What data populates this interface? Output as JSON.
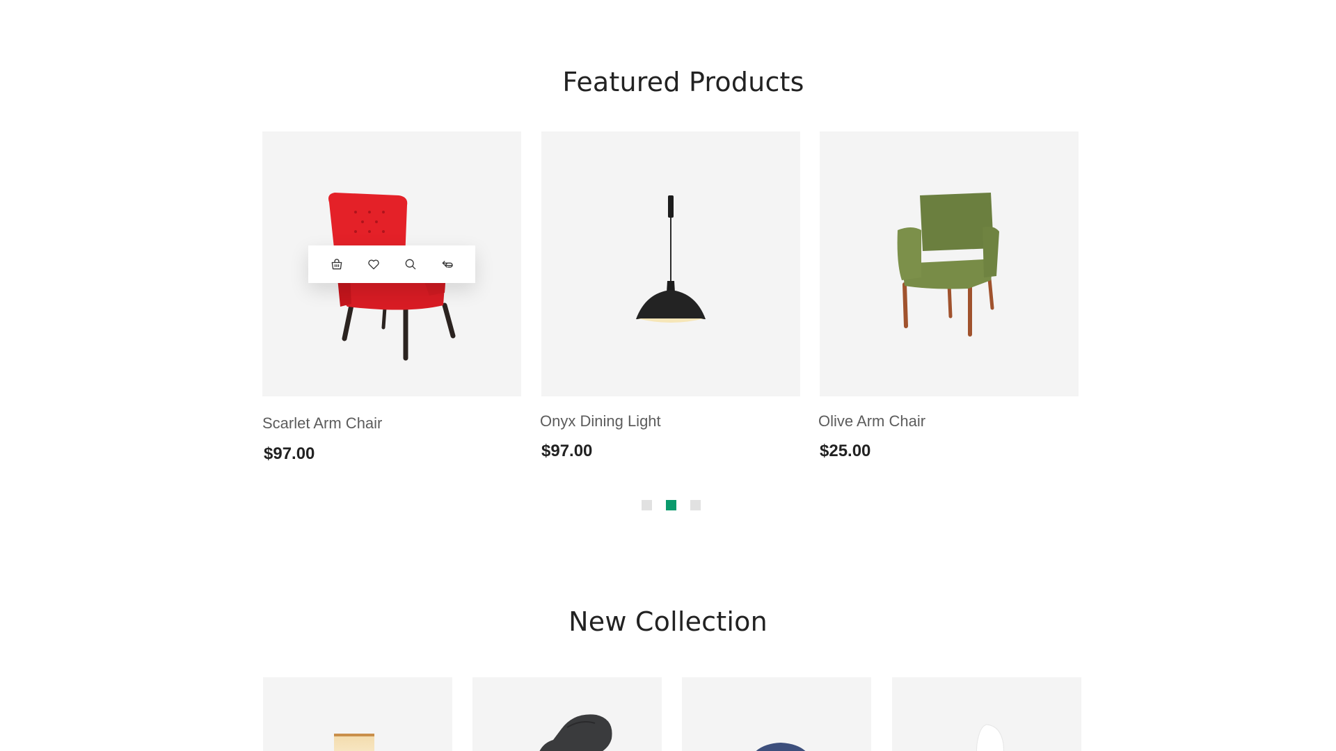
{
  "featured": {
    "title": "Featured Products",
    "products": [
      {
        "name": "Scarlet Arm Chair",
        "price": "$97.00",
        "image_icon": "red-armchair"
      },
      {
        "name": "Onyx Dining Light",
        "price": "$97.00",
        "image_icon": "pendant-lamp"
      },
      {
        "name": "Olive Arm Chair",
        "price": "$25.00",
        "image_icon": "green-armchair"
      }
    ],
    "actions": [
      {
        "icon": "basket-icon"
      },
      {
        "icon": "heart-icon"
      },
      {
        "icon": "search-icon"
      },
      {
        "icon": "compare-icon"
      }
    ],
    "pagination": {
      "total": 3,
      "active_index": 2
    }
  },
  "collection": {
    "title": "New Collection",
    "items": [
      {
        "image_icon": "wood-lamp"
      },
      {
        "image_icon": "black-chair"
      },
      {
        "image_icon": "blue-ottoman"
      },
      {
        "image_icon": "white-vase"
      }
    ]
  },
  "colors": {
    "accent": "#0a9a6c",
    "card_bg": "#f4f4f4",
    "dot_inactive": "#e1e1e1"
  }
}
